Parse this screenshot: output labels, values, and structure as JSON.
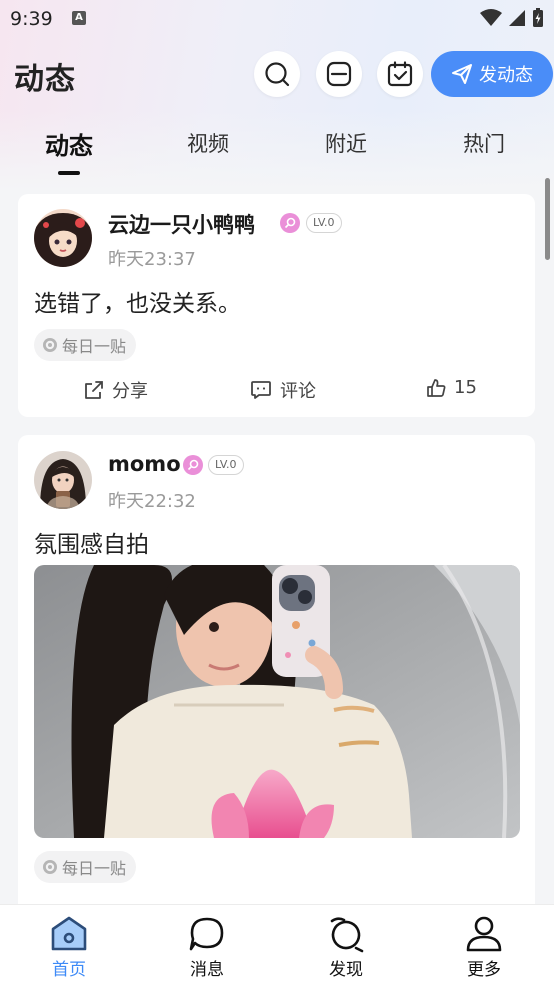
{
  "status_bar": {
    "time": "9:39",
    "notif_letter": "A"
  },
  "header": {
    "title": "动态",
    "post_button_label": "发动态"
  },
  "tabs": [
    {
      "label": "动态",
      "active": true
    },
    {
      "label": "视频",
      "active": false
    },
    {
      "label": "附近",
      "active": false
    },
    {
      "label": "热门",
      "active": false
    }
  ],
  "posts": [
    {
      "username": "云边一只小鸭鸭",
      "level": "LV.0",
      "time": "昨天23:37",
      "text": "选错了，也没关系。",
      "tag": "每日一贴",
      "actions": {
        "share": "分享",
        "comment": "评论",
        "likes": "15"
      }
    },
    {
      "username": "momo",
      "level": "LV.0",
      "time": "昨天22:32",
      "text": "氛围感自拍",
      "tag": "每日一贴"
    }
  ],
  "bottom_nav": [
    {
      "label": "首页",
      "icon": "home-icon",
      "active": true
    },
    {
      "label": "消息",
      "icon": "message-icon",
      "active": false
    },
    {
      "label": "发现",
      "icon": "discover-icon",
      "active": false
    },
    {
      "label": "更多",
      "icon": "profile-icon",
      "active": false
    }
  ],
  "colors": {
    "accent": "#4a8df8",
    "nav_active": "#3d8af7",
    "vip": "#ea8fd8"
  }
}
